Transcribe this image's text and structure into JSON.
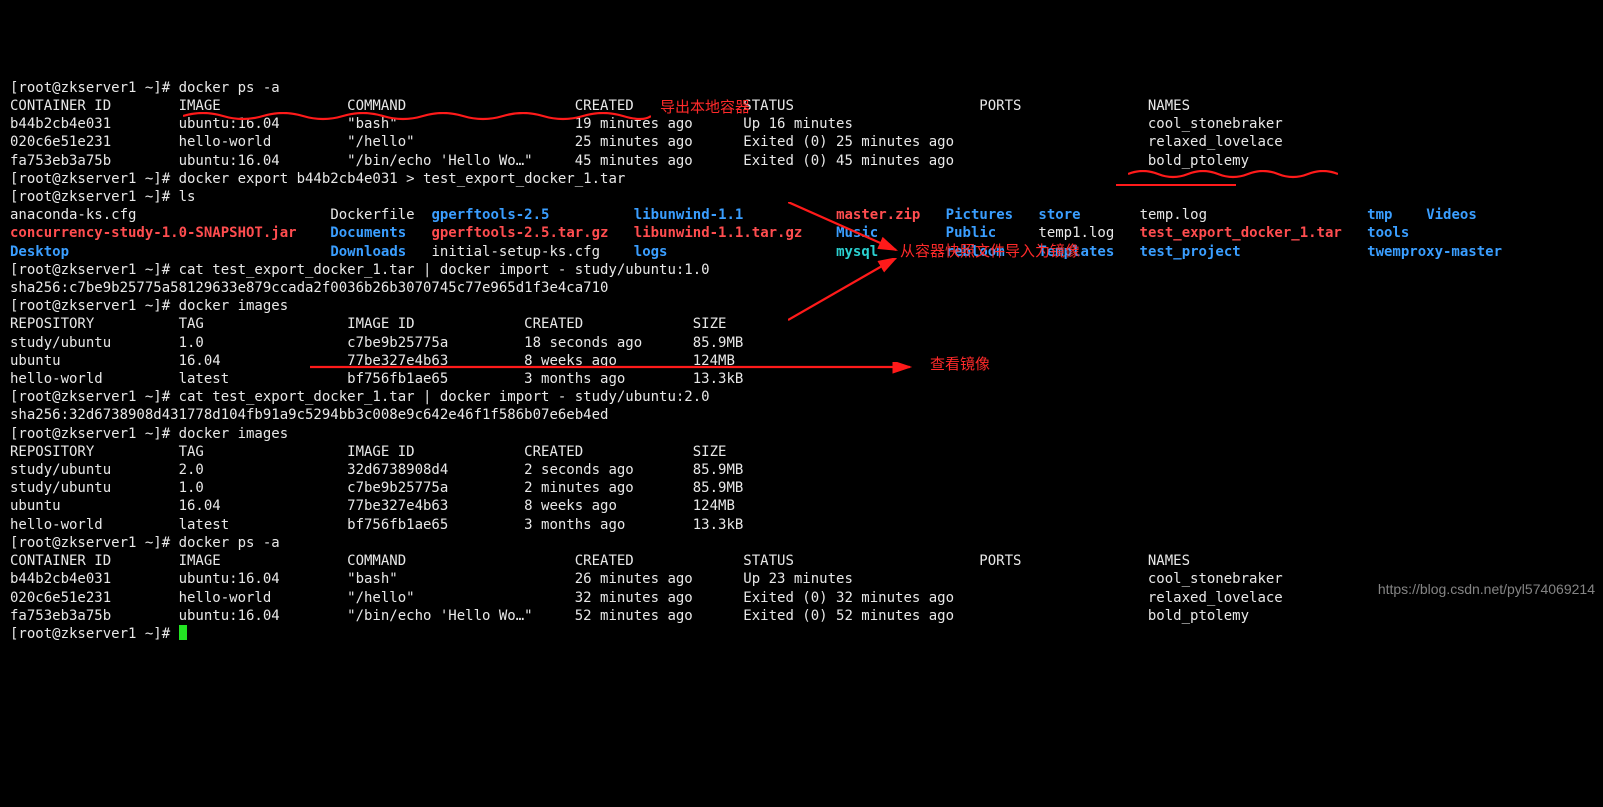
{
  "prompt": "[root@zkserver1 ~]# ",
  "cmds": {
    "ps1": "docker ps -a",
    "export": "docker export b44b2cb4e031 > test_export_docker_1.tar",
    "ls": "ls",
    "cat1": "cat test_export_docker_1.tar | docker import - study/ubuntu:1.0",
    "images1": "docker images",
    "cat2": "cat test_export_docker_1.tar | docker import - study/ubuntu:2.0",
    "images2": "docker images",
    "ps2": "docker ps -a"
  },
  "ps_head": {
    "c1": "CONTAINER ID",
    "c2": "IMAGE",
    "c3": "COMMAND",
    "c4": "CREATED",
    "c5": "STATUS",
    "c6": "PORTS",
    "c7": "NAMES"
  },
  "ps1_rows": [
    {
      "id": "b44b2cb4e031",
      "image": "ubuntu:16.04",
      "cmd": "\"bash\"",
      "created": "19 minutes ago",
      "status": "Up 16 minutes",
      "names": "cool_stonebraker"
    },
    {
      "id": "020c6e51e231",
      "image": "hello-world",
      "cmd": "\"/hello\"",
      "created": "25 minutes ago",
      "status": "Exited (0) 25 minutes ago",
      "names": "relaxed_lovelace"
    },
    {
      "id": "fa753eb3a75b",
      "image": "ubuntu:16.04",
      "cmd": "\"/bin/echo 'Hello Wo…\"",
      "created": "45 minutes ago",
      "status": "Exited (0) 45 minutes ago",
      "names": "bold_ptolemy"
    }
  ],
  "ls_out": {
    "r1": [
      {
        "t": "anaconda-ks.cfg",
        "c": ""
      },
      {
        "t": "Dockerfile",
        "c": ""
      },
      {
        "t": "gperftools-2.5",
        "c": "blue"
      },
      {
        "t": "libunwind-1.1",
        "c": "blue"
      },
      {
        "t": "master.zip",
        "c": "red"
      },
      {
        "t": "Pictures",
        "c": "blue"
      },
      {
        "t": "store",
        "c": "blue"
      },
      {
        "t": "temp.log",
        "c": ""
      },
      {
        "t": "tmp",
        "c": "blue"
      },
      {
        "t": "Videos",
        "c": "blue"
      }
    ],
    "r2": [
      {
        "t": "concurrency-study-1.0-SNAPSHOT.jar",
        "c": "red"
      },
      {
        "t": "Documents",
        "c": "blue"
      },
      {
        "t": "gperftools-2.5.tar.gz",
        "c": "red"
      },
      {
        "t": "libunwind-1.1.tar.gz",
        "c": "red"
      },
      {
        "t": "Music",
        "c": "blue"
      },
      {
        "t": "Public",
        "c": "blue"
      },
      {
        "t": "temp1.log",
        "c": ""
      },
      {
        "t": "test_export_docker_1.tar",
        "c": "red"
      },
      {
        "t": "tools",
        "c": "blue"
      }
    ],
    "r3": [
      {
        "t": "Desktop",
        "c": "blue"
      },
      {
        "t": "Downloads",
        "c": "blue"
      },
      {
        "t": "initial-setup-ks.cfg",
        "c": ""
      },
      {
        "t": "logs",
        "c": "blue"
      },
      {
        "t": "mysql",
        "c": "cyan"
      },
      {
        "t": "rebloom",
        "c": "blue"
      },
      {
        "t": "Templates",
        "c": "blue"
      },
      {
        "t": "test_project",
        "c": "blue"
      },
      {
        "t": "twemproxy-master",
        "c": "blue"
      }
    ]
  },
  "sha1": "sha256:c7be9b25775a58129633e879ccada2f0036b26b3070745c77e965d1f3e4ca710",
  "sha2": "sha256:32d6738908d431778d104fb91a9c5294bb3c008e9c642e46f1f586b07e6eb4ed",
  "imghead": {
    "c1": "REPOSITORY",
    "c2": "TAG",
    "c3": "IMAGE ID",
    "c4": "CREATED",
    "c5": "SIZE"
  },
  "img1_rows": [
    {
      "repo": "study/ubuntu",
      "tag": "1.0",
      "id": "c7be9b25775a",
      "created": "18 seconds ago",
      "size": "85.9MB"
    },
    {
      "repo": "ubuntu",
      "tag": "16.04",
      "id": "77be327e4b63",
      "created": "8 weeks ago",
      "size": "124MB"
    },
    {
      "repo": "hello-world",
      "tag": "latest",
      "id": "bf756fb1ae65",
      "created": "3 months ago",
      "size": "13.3kB"
    }
  ],
  "img2_rows": [
    {
      "repo": "study/ubuntu",
      "tag": "2.0",
      "id": "32d6738908d4",
      "created": "2 seconds ago",
      "size": "85.9MB"
    },
    {
      "repo": "study/ubuntu",
      "tag": "1.0",
      "id": "c7be9b25775a",
      "created": "2 minutes ago",
      "size": "85.9MB"
    },
    {
      "repo": "ubuntu",
      "tag": "16.04",
      "id": "77be327e4b63",
      "created": "8 weeks ago",
      "size": "124MB"
    },
    {
      "repo": "hello-world",
      "tag": "latest",
      "id": "bf756fb1ae65",
      "created": "3 months ago",
      "size": "13.3kB"
    }
  ],
  "ps2_rows": [
    {
      "id": "b44b2cb4e031",
      "image": "ubuntu:16.04",
      "cmd": "\"bash\"",
      "created": "26 minutes ago",
      "status": "Up 23 minutes",
      "names": "cool_stonebraker"
    },
    {
      "id": "020c6e51e231",
      "image": "hello-world",
      "cmd": "\"/hello\"",
      "created": "32 minutes ago",
      "status": "Exited (0) 32 minutes ago",
      "names": "relaxed_lovelace"
    },
    {
      "id": "fa753eb3a75b",
      "image": "ubuntu:16.04",
      "cmd": "\"/bin/echo 'Hello Wo…\"",
      "created": "52 minutes ago",
      "status": "Exited (0) 52 minutes ago",
      "names": "bold_ptolemy"
    }
  ],
  "annotations": {
    "a1": "导出本地容器",
    "a2": "从容器快照文件导入为镜像",
    "a3": "查看镜像"
  },
  "watermark": "https://blog.csdn.net/pyl574069214"
}
